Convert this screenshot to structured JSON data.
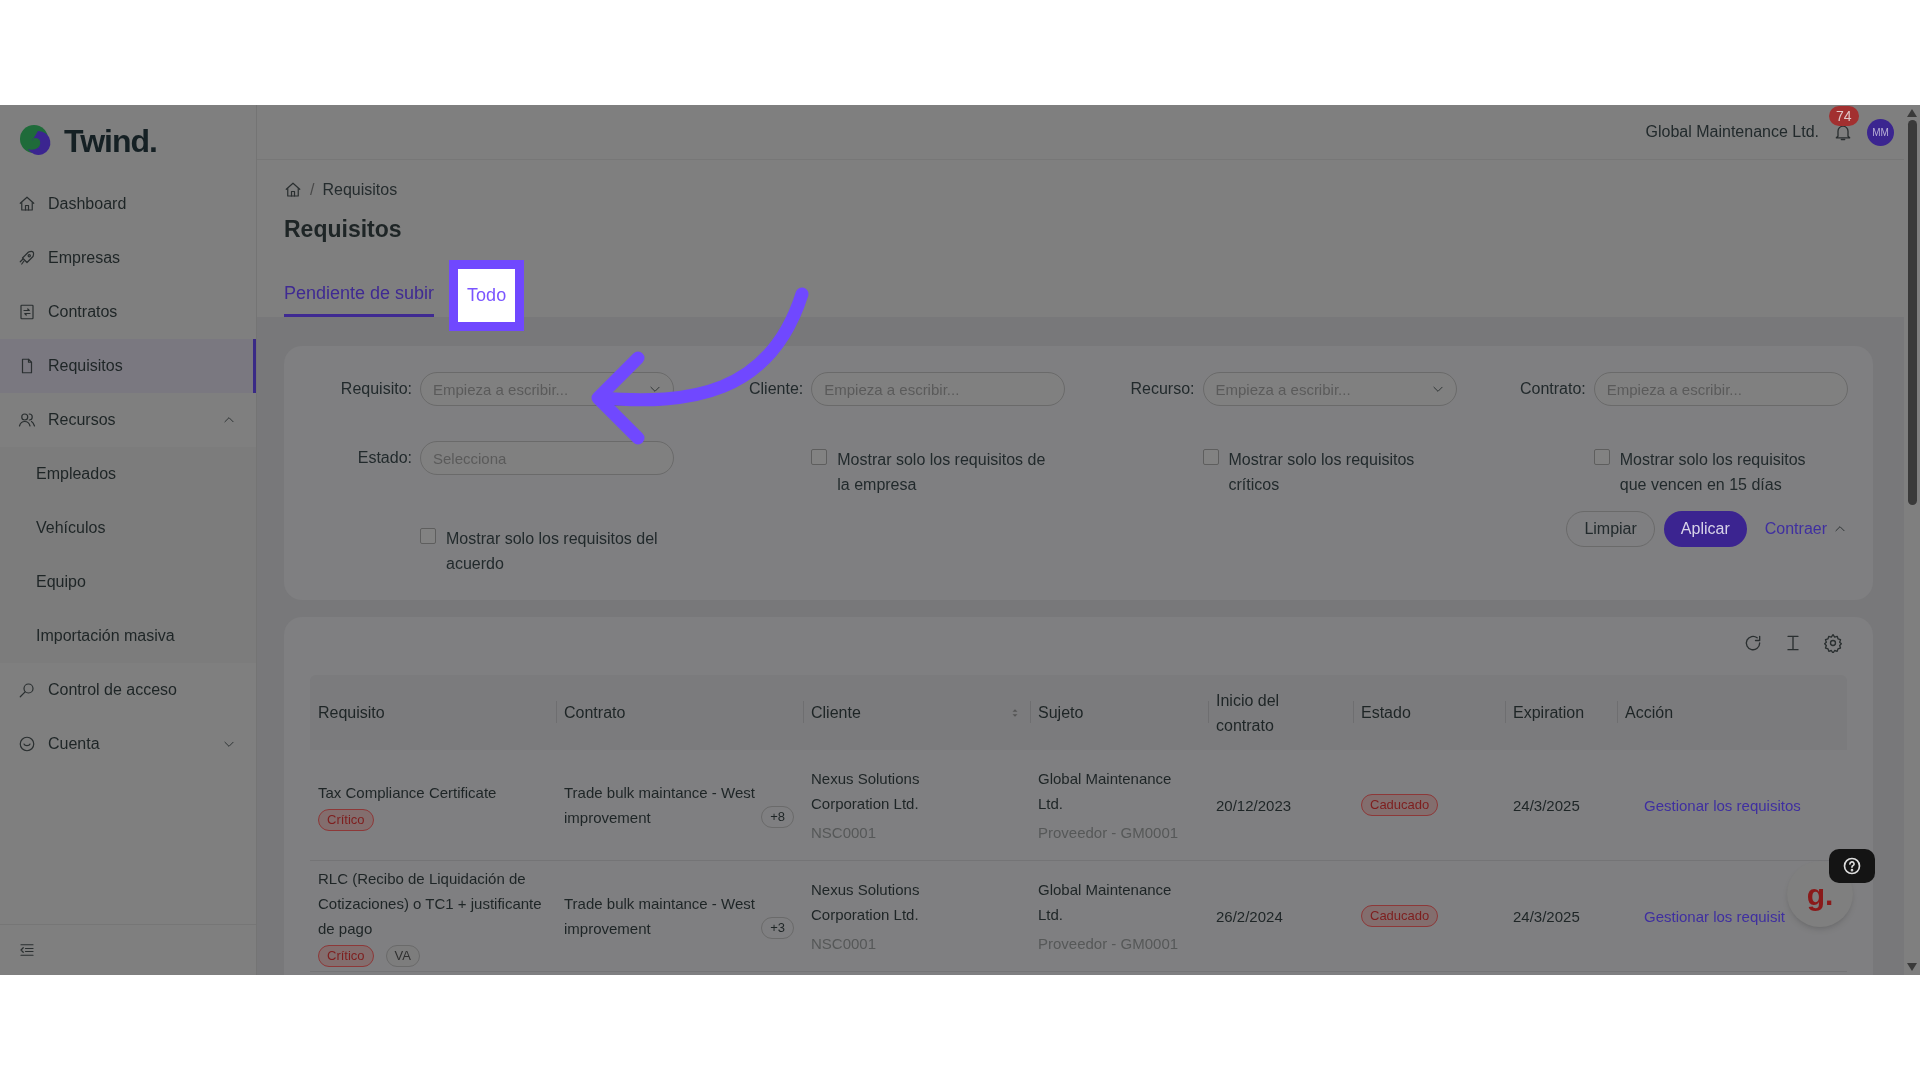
{
  "sidebar": {
    "logo": "Twind.",
    "items": [
      {
        "label": "Dashboard",
        "kind": "link",
        "selected": false
      },
      {
        "label": "Empresas",
        "kind": "link",
        "selected": false
      },
      {
        "label": "Contratos",
        "kind": "link",
        "selected": false
      },
      {
        "label": "Requisitos",
        "kind": "link",
        "selected": true
      },
      {
        "label": "Recursos",
        "kind": "group",
        "selected": false,
        "expanded": true,
        "children": [
          {
            "label": "Empleados"
          },
          {
            "label": "Vehículos"
          },
          {
            "label": "Equipo"
          },
          {
            "label": "Importación masiva"
          }
        ]
      },
      {
        "label": "Control de acceso",
        "kind": "link",
        "selected": false
      },
      {
        "label": "Cuenta",
        "kind": "group",
        "selected": false,
        "expanded": false
      }
    ]
  },
  "header": {
    "company": "Global Maintenance Ltd.",
    "notifications": "74",
    "avatar": "MM"
  },
  "breadcrumb": {
    "separator": "/",
    "items": [
      "Requisitos"
    ]
  },
  "title": "Requisitos",
  "tabs": [
    {
      "label": "Pendiente de subir",
      "selected": true,
      "highlighted": false
    },
    {
      "label": "Todo",
      "selected": false,
      "highlighted": true
    }
  ],
  "filters": {
    "fields": [
      {
        "label": "Requisito:",
        "placeholder": "Empieza a escribir...",
        "kind": "select"
      },
      {
        "label": "Cliente:",
        "placeholder": "Empieza a escribir...",
        "kind": "text"
      },
      {
        "label": "Recurso:",
        "placeholder": "Empieza a escribir...",
        "kind": "select"
      },
      {
        "label": "Contrato:",
        "placeholder": "Empieza a escribir...",
        "kind": "text"
      },
      {
        "label": "Estado:",
        "placeholder": "Selecciona",
        "kind": "text"
      }
    ],
    "checkboxes": [
      {
        "label": "Mostrar solo los requisitos de la empresa",
        "checked": false
      },
      {
        "label": "Mostrar solo los requisitos críticos",
        "checked": false
      },
      {
        "label": "Mostrar solo los requisitos que vencen en 15 días",
        "checked": false
      },
      {
        "label": "Mostrar solo los requisitos del acuerdo",
        "checked": false
      }
    ],
    "clear": "Limpiar",
    "apply": "Aplicar",
    "collapse": "Contraer"
  },
  "table": {
    "columns": [
      {
        "label": "Requisito",
        "sortable": false
      },
      {
        "label": "Contrato",
        "sortable": false
      },
      {
        "label": "Cliente",
        "sortable": true
      },
      {
        "label": "Sujeto",
        "sortable": false
      },
      {
        "label": "Inicio del contrato",
        "sortable": false
      },
      {
        "label": "Estado",
        "sortable": false
      },
      {
        "label": "Expiration",
        "sortable": false
      },
      {
        "label": "Acción",
        "sortable": false
      }
    ],
    "rows": [
      {
        "requisito": "Tax Compliance Certificate",
        "tags": [
          {
            "label": "Crítico",
            "kind": "critical"
          }
        ],
        "contrato": "Trade bulk maintance - West improvement",
        "contrato_more": "+8",
        "cliente": "Nexus Solutions Corporation Ltd.",
        "cliente_code": "NSC0001",
        "sujeto": "Global Maintenance Ltd.",
        "sujeto_role": "Proveedor - GM0001",
        "inicio": "20/12/2023",
        "estado": "Caducado",
        "expiration": "24/3/2025",
        "accion": "Gestionar los requisitos"
      },
      {
        "requisito": "RLC (Recibo de Liquidación de Cotizaciones) o TC1 + justificante de pago",
        "tags": [
          {
            "label": "Crítico",
            "kind": "critical"
          },
          {
            "label": "VA",
            "kind": "neutral"
          }
        ],
        "contrato": "Trade bulk maintance - West improvement",
        "contrato_more": "+3",
        "cliente": "Nexus Solutions Corporation Ltd.",
        "cliente_code": "NSC0001",
        "sujeto": "Global Maintenance Ltd.",
        "sujeto_role": "Proveedor - GM0001",
        "inicio": "26/2/2024",
        "estado": "Caducado",
        "expiration": "24/3/2025",
        "accion": "Gestionar los requisit"
      }
    ]
  },
  "help_widget": {
    "logo": "g."
  }
}
